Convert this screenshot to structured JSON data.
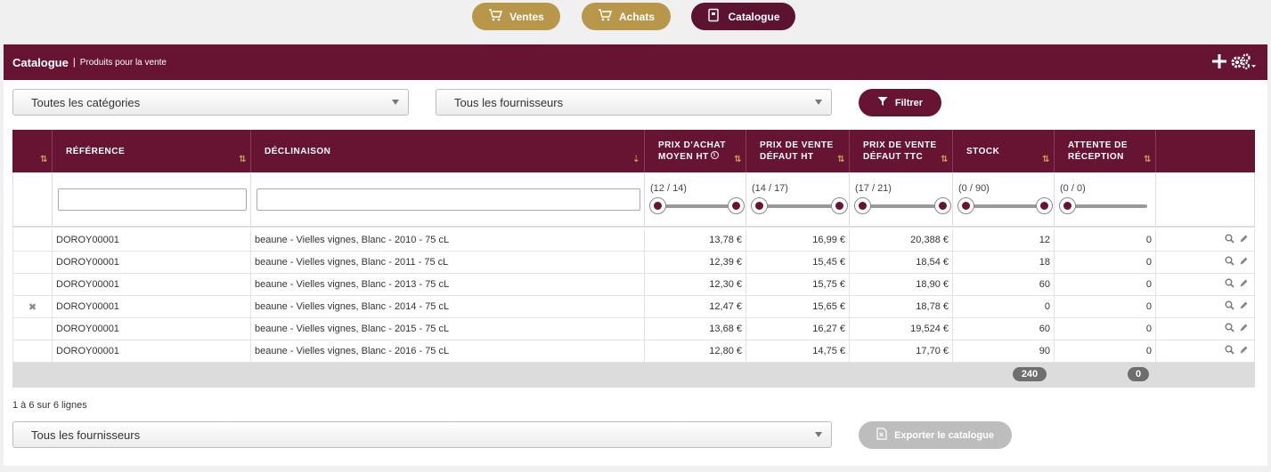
{
  "nav": {
    "ventes": "Ventes",
    "achats": "Achats",
    "catalogue": "Catalogue"
  },
  "header": {
    "title": "Catalogue",
    "separator": "|",
    "subtitle": "Produits pour la vente"
  },
  "filters": {
    "categories": "Toutes les catégories",
    "fournisseurs": "Tous les fournisseurs",
    "filter_button": "Filtrer"
  },
  "table": {
    "columns": {
      "reference": "RÉFÉRENCE",
      "declinaison": "DÉCLINAISON",
      "prix_achat": "PRIX D'ACHAT MOYEN HT",
      "prix_vente_ht": "PRIX DE VENTE DÉFAUT HT",
      "prix_vente_ttc": "PRIX DE VENTE DÉFAUT TTC",
      "stock": "STOCK",
      "attente": "ATTENTE DE RÉCEPTION"
    },
    "info_glyph": "i",
    "ranges": {
      "prix_achat": "(12 / 14)",
      "prix_vente_ht": "(14 / 17)",
      "prix_vente_ttc": "(17 / 21)",
      "stock": "(0 / 90)",
      "attente": "(0 / 0)"
    },
    "rows": [
      {
        "ref": "DOROY00001",
        "decl": "beaune - Vielles vignes, Blanc - 2010 - 75 cL",
        "achat": "13,78 €",
        "vht": "16,99 €",
        "vttc": "20,388 €",
        "stock": "12",
        "attente": "0"
      },
      {
        "ref": "DOROY00001",
        "decl": "beaune - Vielles vignes, Blanc - 2011 - 75 cL",
        "achat": "12,39 €",
        "vht": "15,45 €",
        "vttc": "18,54 €",
        "stock": "18",
        "attente": "0"
      },
      {
        "ref": "DOROY00001",
        "decl": "beaune - Vielles vignes, Blanc - 2013 - 75 cL",
        "achat": "12,30 €",
        "vht": "15,75 €",
        "vttc": "18,90 €",
        "stock": "60",
        "attente": "0"
      },
      {
        "ref": "DOROY00001",
        "decl": "beaune - Vielles vignes, Blanc - 2014 - 75 cL",
        "achat": "12,47 €",
        "vht": "15,65 €",
        "vttc": "18,78 €",
        "stock": "0",
        "attente": "0"
      },
      {
        "ref": "DOROY00001",
        "decl": "beaune - Vielles vignes, Blanc - 2015 - 75 cL",
        "achat": "13,68 €",
        "vht": "16,27 €",
        "vttc": "19,524 €",
        "stock": "60",
        "attente": "0"
      },
      {
        "ref": "DOROY00001",
        "decl": "beaune - Vielles vignes, Blanc - 2016 - 75 cL",
        "achat": "12,80 €",
        "vht": "14,75 €",
        "vttc": "17,70 €",
        "stock": "90",
        "attente": "0"
      }
    ],
    "totals": {
      "stock": "240",
      "attente": "0"
    },
    "remove_glyph": "✖"
  },
  "footer": {
    "count_text": "1 à 6 sur 6 lignes",
    "fournisseurs": "Tous les fournisseurs",
    "export_button": "Exporter le catalogue"
  },
  "icons": {
    "cart": "cart-icon",
    "book": "book-icon",
    "plus": "plus-icon",
    "gears": "gears-icon",
    "filter": "filter-icon",
    "sort": "sort-icon",
    "info": "info-icon",
    "search": "search-icon",
    "edit": "pencil-icon",
    "remove": "remove-icon",
    "excel": "excel-icon"
  },
  "colors": {
    "primary": "#661432",
    "gold": "#b8974a",
    "active_nav": "#5c1330",
    "disabled": "#bdbdbd",
    "footer_row": "#dcdcdc",
    "pill": "#6e6e6e"
  }
}
